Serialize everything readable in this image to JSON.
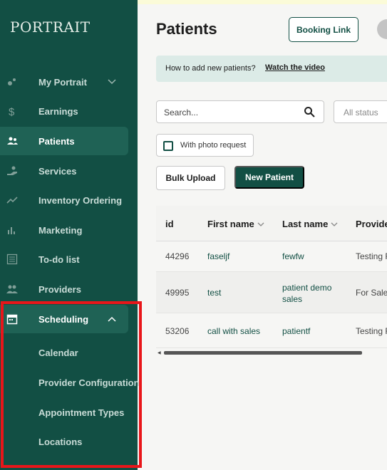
{
  "sidebar": {
    "logo": "PORTRAIT",
    "items": [
      {
        "label": "My Portrait",
        "icon": "dots-icon"
      },
      {
        "label": "Earnings",
        "icon": "dollar-icon"
      },
      {
        "label": "Patients",
        "icon": "users-icon"
      },
      {
        "label": "Services",
        "icon": "hand-icon"
      },
      {
        "label": "Inventory Ordering",
        "icon": "trend-icon"
      },
      {
        "label": "Marketing",
        "icon": "bar-chart-icon"
      },
      {
        "label": "To-do list",
        "icon": "list-icon"
      },
      {
        "label": "Providers",
        "icon": "people-icon"
      },
      {
        "label": "Scheduling",
        "icon": "calendar-icon"
      }
    ],
    "scheduling_sub": [
      "Calendar",
      "Provider Configuration",
      "Appointment Types",
      "Locations"
    ]
  },
  "header": {
    "title": "Patients",
    "booking_link": "Booking Link"
  },
  "banner": {
    "question": "How to add new patients?",
    "link": "Watch the video"
  },
  "filters": {
    "search_placeholder": "Search...",
    "status_placeholder": "All status",
    "photo_request": "With photo request"
  },
  "actions": {
    "bulk_upload": "Bulk Upload",
    "new_patient": "New Patient"
  },
  "table": {
    "columns": [
      "id",
      "First name",
      "Last name",
      "Provide"
    ],
    "rows": [
      {
        "id": "44296",
        "first": "faseljf",
        "last": "fewfw",
        "provider": "Testing F"
      },
      {
        "id": "49995",
        "first": "test",
        "last": "patient demo sales",
        "provider": "For Sales"
      },
      {
        "id": "53206",
        "first": "call with sales",
        "last": "patientf",
        "provider": "Testing F"
      }
    ]
  },
  "colors": {
    "sidebar": "#124f44",
    "accent": "#124f44",
    "highlight_box": "#e8161a"
  }
}
